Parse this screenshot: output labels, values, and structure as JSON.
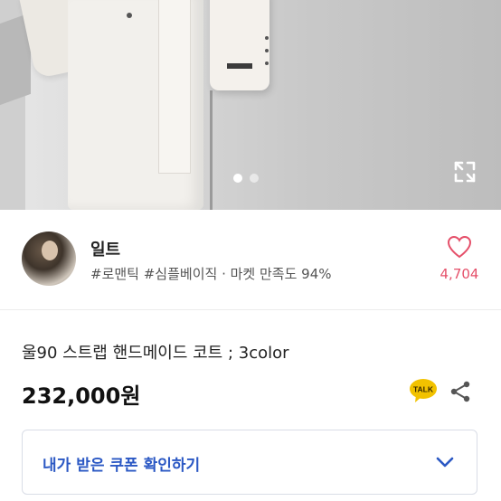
{
  "product_image": {
    "slide_count": 2,
    "active_slide": 1,
    "expand_icon": "expand-icon"
  },
  "seller": {
    "name": "일트",
    "tags": "#로맨틱 #심플베이직 · 마켓 만족도 94%",
    "likes": "4,704",
    "heart_icon": "heart-outline-icon"
  },
  "product": {
    "title": "울90 스트랩 핸드메이드 코트 ; 3color",
    "price": "232,000원",
    "talk_icon_label": "TALK",
    "share_icon": "share-icon"
  },
  "coupon": {
    "label": "내가 받은 쿠폰 확인하기",
    "chevron_icon": "chevron-down-icon"
  },
  "colors": {
    "accent_blue": "#2b58c4",
    "like_red": "#e5506a",
    "talk_yellow": "#f2c200"
  }
}
